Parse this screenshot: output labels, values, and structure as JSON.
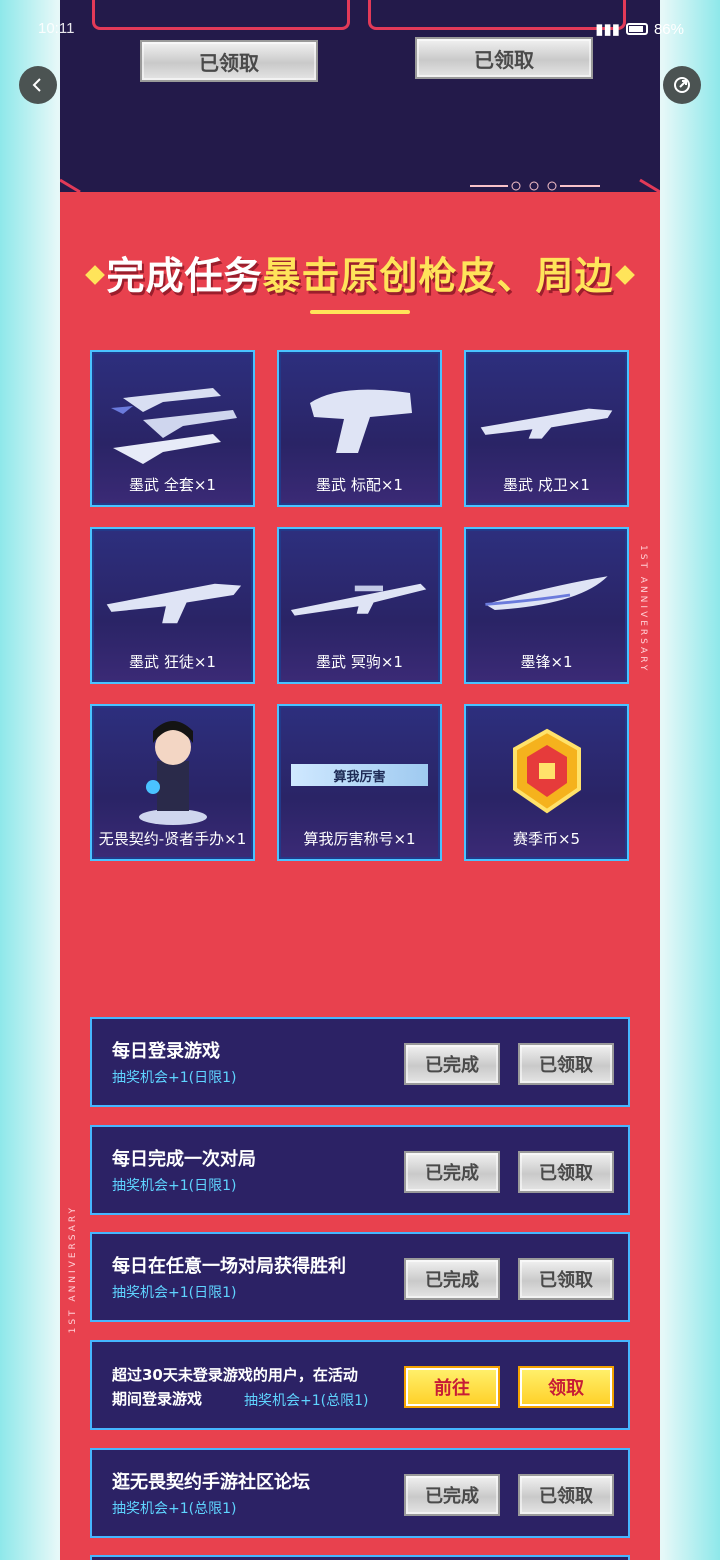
{
  "status": {
    "time": "10:11",
    "battery": "86%"
  },
  "nav": {
    "back_icon": "chevron-left-icon",
    "share_icon": "share-icon"
  },
  "top": {
    "claimed_label_1": "已领取",
    "claimed_label_2": "已领取"
  },
  "section": {
    "title_white": "完成任务",
    "title_yellow": "暴击原创枪皮、周边"
  },
  "side_text": "1ST ANNIVERSARY",
  "rewards": [
    {
      "label": "墨武 全套×1",
      "icon": "weapon-set-icon"
    },
    {
      "label": "墨武 标配×1",
      "icon": "pistol-icon"
    },
    {
      "label": "墨武 戍卫×1",
      "icon": "rifle-icon"
    },
    {
      "label": "墨武 狂徒×1",
      "icon": "rifle-icon"
    },
    {
      "label": "墨武 冥驹×1",
      "icon": "sniper-icon"
    },
    {
      "label": "墨锋×1",
      "icon": "blade-icon"
    },
    {
      "label": "无畏契约-贤者手办×1",
      "icon": "figure-icon"
    },
    {
      "label": "算我厉害称号×1",
      "tag": "算我厉害",
      "icon": "title-tag-icon"
    },
    {
      "label": "赛季币×5",
      "icon": "coin-icon"
    }
  ],
  "tasks": [
    {
      "title": "每日登录游戏",
      "sub": "抽奖机会+1(日限1)",
      "btn1": "已完成",
      "btn2": "已领取"
    },
    {
      "title": "每日完成一次对局",
      "sub": "抽奖机会+1(日限1)",
      "btn1": "已完成",
      "btn2": "已领取"
    },
    {
      "title": "每日在任意一场对局获得胜利",
      "sub": "抽奖机会+1(日限1)",
      "btn1": "已完成",
      "btn2": "已领取"
    },
    {
      "title_line1": "超过30天未登录游戏的用户，在活动",
      "title_line2": "期间登录游戏",
      "sub": "抽奖机会+1(总限1)",
      "btn1": "前往",
      "btn2": "领取"
    },
    {
      "title": "逛无畏契约手游社区论坛",
      "sub": "抽奖机会+1(总限1)",
      "btn1": "已完成",
      "btn2": "已领取"
    }
  ]
}
